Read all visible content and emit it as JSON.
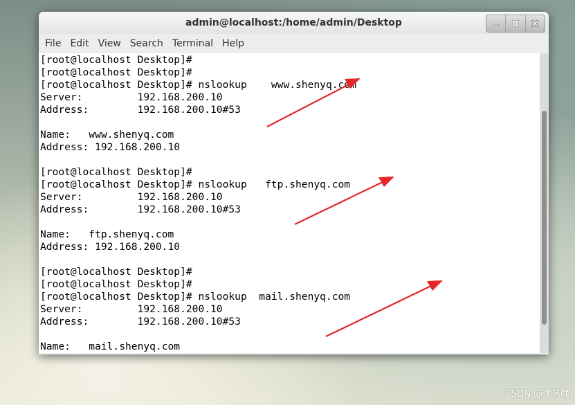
{
  "window": {
    "title": "admin@localhost:/home/admin/Desktop",
    "buttons": [
      {
        "name": "minimize-icon"
      },
      {
        "name": "maximize-icon"
      },
      {
        "name": "close-icon"
      }
    ]
  },
  "menubar": {
    "items": [
      "File",
      "Edit",
      "View",
      "Search",
      "Terminal",
      "Help"
    ]
  },
  "terminal": {
    "lines": [
      "[root@localhost Desktop]#",
      "[root@localhost Desktop]#",
      "[root@localhost Desktop]# nslookup    www.shenyq.com",
      "Server:         192.168.200.10",
      "Address:        192.168.200.10#53",
      "",
      "Name:   www.shenyq.com",
      "Address: 192.168.200.10",
      "",
      "[root@localhost Desktop]#",
      "[root@localhost Desktop]# nslookup   ftp.shenyq.com",
      "Server:         192.168.200.10",
      "Address:        192.168.200.10#53",
      "",
      "Name:   ftp.shenyq.com",
      "Address: 192.168.200.10",
      "",
      "[root@localhost Desktop]#",
      "[root@localhost Desktop]#",
      "[root@localhost Desktop]# nslookup  mail.shenyq.com",
      "Server:         192.168.200.10",
      "Address:        192.168.200.10#53",
      "",
      "Name:   mail.shenyq.com"
    ]
  },
  "annotations": {
    "arrow_color": "#e5262a"
  },
  "watermark": "CSDN @沈艺强"
}
